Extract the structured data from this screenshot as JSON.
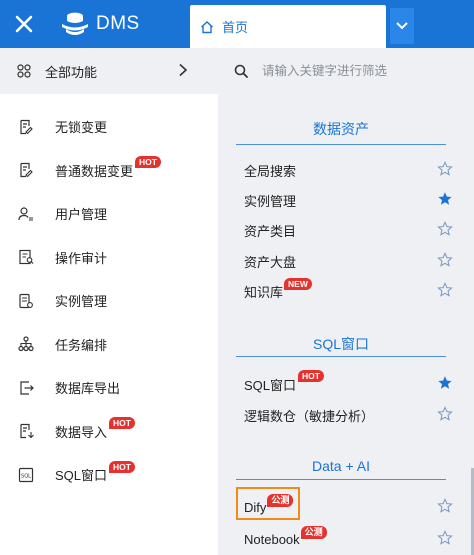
{
  "topbar": {
    "close_icon": "close-icon",
    "logo_text": "DMS",
    "home_tab_label": "首页",
    "accent": "#1a74d6"
  },
  "sidebar": {
    "all_label": "全部功能",
    "items": [
      {
        "label": "无锁变更",
        "badge": ""
      },
      {
        "label": "普通数据变更",
        "badge": "HOT"
      },
      {
        "label": "用户管理",
        "badge": ""
      },
      {
        "label": "操作审计",
        "badge": ""
      },
      {
        "label": "实例管理",
        "badge": ""
      },
      {
        "label": "任务编排",
        "badge": ""
      },
      {
        "label": "数据库导出",
        "badge": ""
      },
      {
        "label": "数据导入",
        "badge": "HOT"
      },
      {
        "label": "SQL窗口",
        "badge": "HOT"
      }
    ]
  },
  "search": {
    "placeholder": "请输入关键字进行筛选"
  },
  "sections": [
    {
      "title": "数据资产",
      "items": [
        {
          "label": "全局搜索",
          "badge": "",
          "starred": false
        },
        {
          "label": "实例管理",
          "badge": "",
          "starred": true
        },
        {
          "label": "资产类目",
          "badge": "",
          "starred": false
        },
        {
          "label": "资产大盘",
          "badge": "",
          "starred": false
        },
        {
          "label": "知识库",
          "badge": "NEW",
          "starred": false
        }
      ]
    },
    {
      "title": "SQL窗口",
      "items": [
        {
          "label": "SQL窗口",
          "badge": "HOT",
          "starred": true
        },
        {
          "label": "逻辑数仓（敏捷分析）",
          "badge": "",
          "starred": false
        }
      ]
    },
    {
      "title": "Data + AI",
      "items": [
        {
          "label": "Dify",
          "badge": "公测",
          "starred": false
        },
        {
          "label": "Notebook",
          "badge": "公测",
          "starred": false
        }
      ]
    }
  ]
}
